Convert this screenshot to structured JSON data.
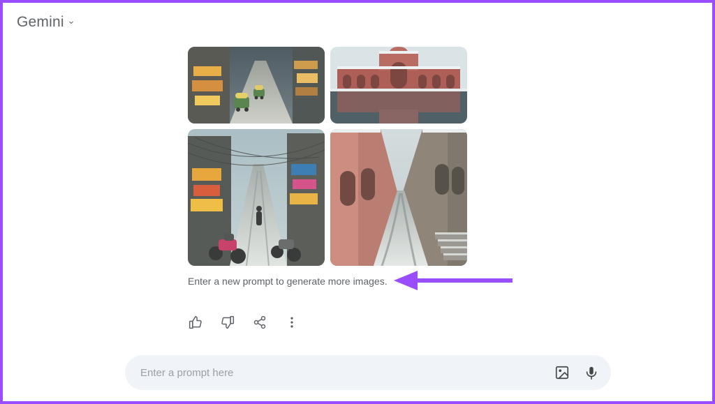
{
  "header": {
    "title": "Gemini"
  },
  "response": {
    "caption": "Enter a new prompt to generate more images.",
    "images": [
      "gen-image-1",
      "gen-image-2",
      "gen-image-3",
      "gen-image-4"
    ]
  },
  "actions": {
    "thumbs_up": "thumbs-up-icon",
    "thumbs_down": "thumbs-down-icon",
    "share": "share-icon",
    "more": "more-icon"
  },
  "prompt": {
    "placeholder": "Enter a prompt here",
    "value": ""
  }
}
